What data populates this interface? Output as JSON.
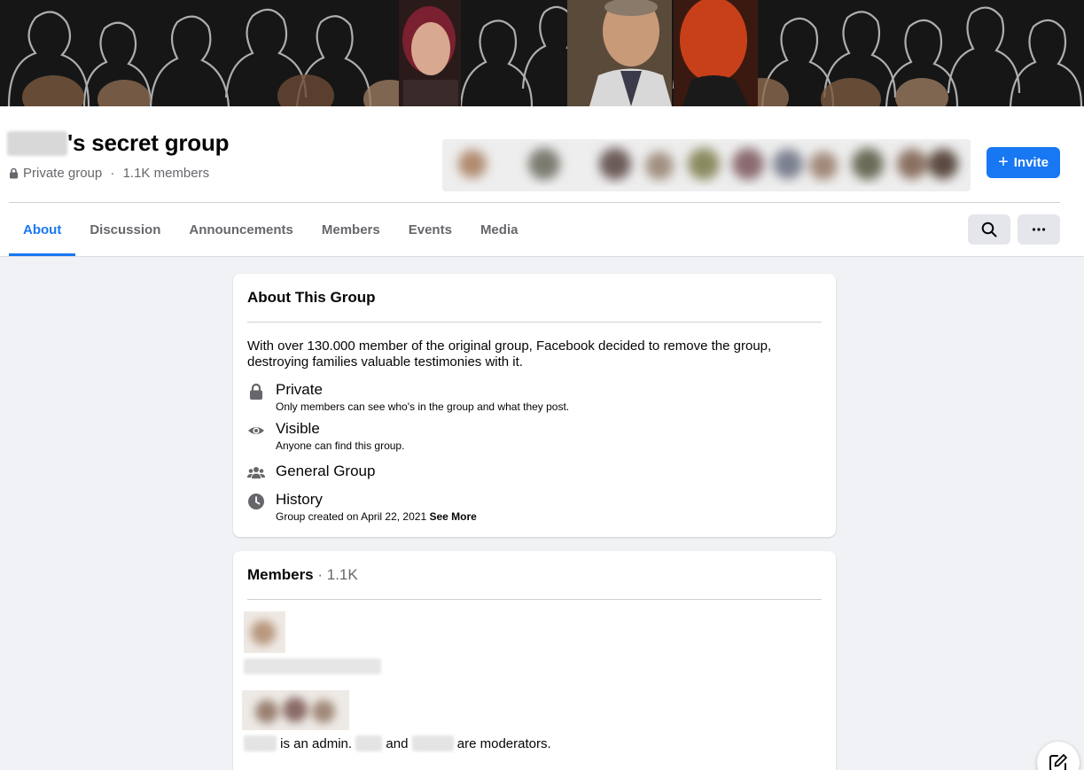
{
  "group": {
    "title_suffix": "'s secret group",
    "privacy_label": "Private group",
    "separator": " · ",
    "member_count": "1.1K members"
  },
  "actions": {
    "invite_label": "Invite"
  },
  "tabs": [
    {
      "label": "About",
      "active": true
    },
    {
      "label": "Discussion",
      "active": false
    },
    {
      "label": "Announcements",
      "active": false
    },
    {
      "label": "Members",
      "active": false
    },
    {
      "label": "Events",
      "active": false
    },
    {
      "label": "Media",
      "active": false
    }
  ],
  "about": {
    "heading": "About This Group",
    "description": "With over 130.000 member of the original group, Facebook decided to remove the group, destroying families valuable testimonies with it.",
    "items": [
      {
        "icon": "lock-icon",
        "title": "Private",
        "subtitle": "Only members can see who's in the group and what they post."
      },
      {
        "icon": "eye-icon",
        "title": "Visible",
        "subtitle": "Anyone can find this group."
      },
      {
        "icon": "people-icon",
        "title": "General Group",
        "subtitle": ""
      },
      {
        "icon": "clock-icon",
        "title": "History",
        "subtitle": "Group created on April 22, 2021",
        "link": "See More"
      }
    ]
  },
  "members_card": {
    "heading": "Members",
    "count": " · 1.1K",
    "admin_text": " is an admin. ",
    "and_text": " and ",
    "moderators_text": " are moderators."
  },
  "colors": {
    "accent": "#1877f2",
    "secondary_text": "#65676b",
    "page_bg": "#f0f2f5"
  }
}
